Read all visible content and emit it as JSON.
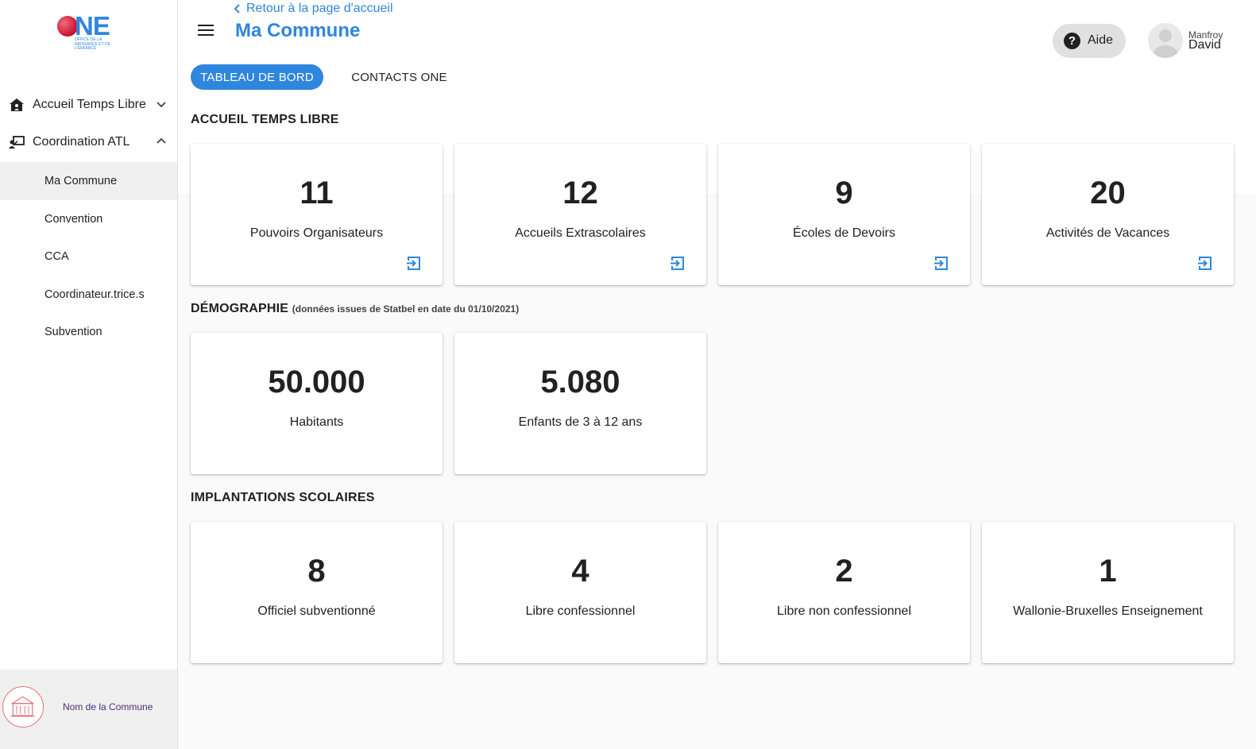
{
  "app": {
    "logo_text": "NE",
    "logo_subtitle": "OFFICE DE LA NAISSANCE ET DE L'ENFANCE"
  },
  "sidebar": {
    "groups": [
      {
        "label": "Accueil Temps Libre",
        "icon": "house-child-icon",
        "expanded": false
      },
      {
        "label": "Coordination ATL",
        "icon": "teacher-board-icon",
        "expanded": true
      }
    ],
    "items": [
      {
        "label": "Ma Commune",
        "active": true
      },
      {
        "label": "Convention",
        "active": false
      },
      {
        "label": "CCA",
        "active": false
      },
      {
        "label": "Coordinateur.trice.s",
        "active": false
      },
      {
        "label": "Subvention",
        "active": false
      }
    ],
    "commune_name": "Nom de la Commune"
  },
  "header": {
    "back_label": "Retour à la page d'accueil",
    "title": "Ma Commune",
    "help_label": "Aide",
    "user_first": "Manfroy",
    "user_last": "David"
  },
  "tabs": [
    {
      "label": "TABLEAU DE BORD",
      "active": true
    },
    {
      "label": "CONTACTS ONE",
      "active": false
    }
  ],
  "sections": {
    "atl": {
      "title": "ACCUEIL TEMPS LIBRE",
      "cards": [
        {
          "value": "11",
          "label": "Pouvoirs Organisateurs"
        },
        {
          "value": "12",
          "label": "Accueils Extrascolaires"
        },
        {
          "value": "9",
          "label": "Écoles de Devoirs"
        },
        {
          "value": "20",
          "label": "Activités de Vacances"
        }
      ]
    },
    "demo": {
      "title": "DÉMOGRAPHIE",
      "note": "(données issues de Statbel en date du 01/10/2021)",
      "cards": [
        {
          "value": "50.000",
          "label": "Habitants"
        },
        {
          "value": "5.080",
          "label": "Enfants de 3 à 12 ans"
        }
      ]
    },
    "schools": {
      "title": "IMPLANTATIONS SCOLAIRES",
      "cards": [
        {
          "value": "8",
          "label": "Officiel subventionné"
        },
        {
          "value": "4",
          "label": "Libre confessionnel"
        },
        {
          "value": "2",
          "label": "Libre non confessionnel"
        },
        {
          "value": "1",
          "label": "Wallonie-Bruxelles Enseignement"
        }
      ]
    }
  },
  "colors": {
    "accent": "#2e86de",
    "brand_red": "#c8102e",
    "background": "#fafafa"
  }
}
